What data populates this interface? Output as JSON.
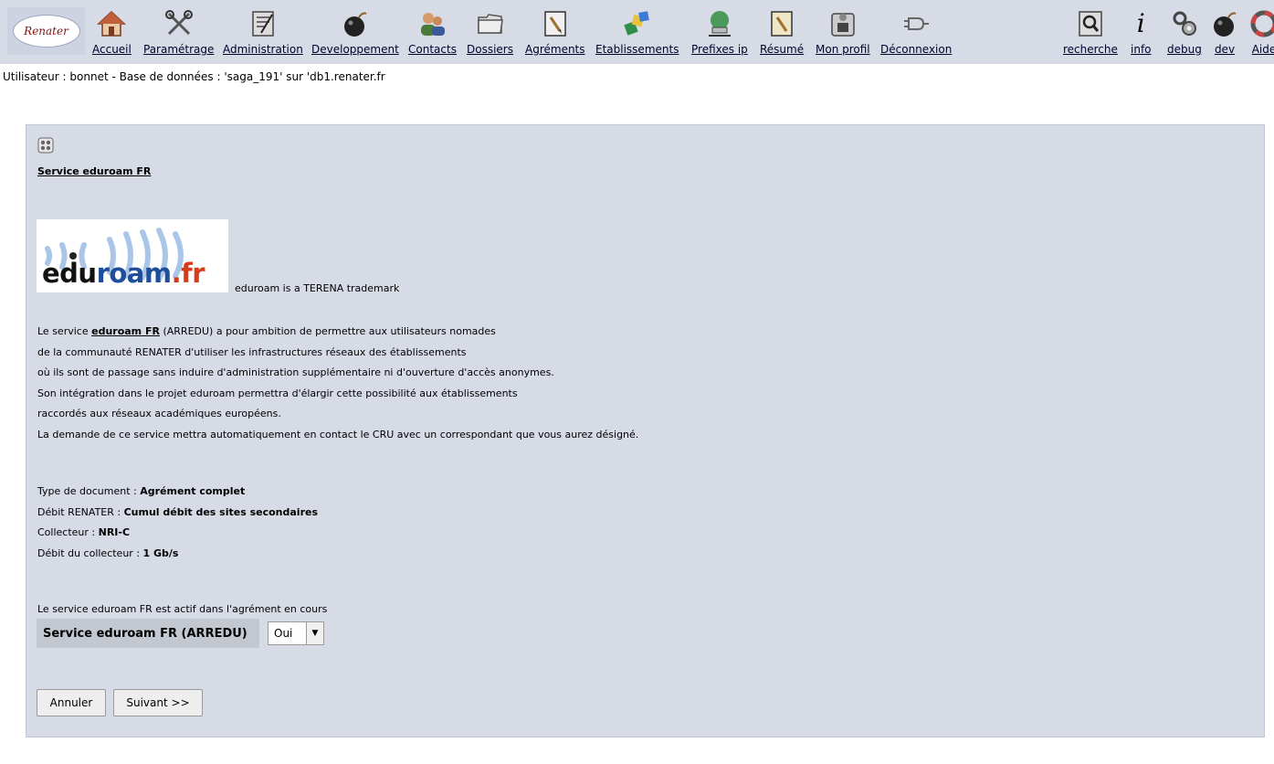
{
  "toolbar": {
    "logo_text": "Renater",
    "items": [
      {
        "label": "Accueil",
        "icon": "house-icon"
      },
      {
        "label": "Paramétrage",
        "icon": "tools-icon"
      },
      {
        "label": "Administration",
        "icon": "admin-icon"
      },
      {
        "label": "Developpement",
        "icon": "bomb-icon"
      },
      {
        "label": "Contacts",
        "icon": "people-icon"
      },
      {
        "label": "Dossiers",
        "icon": "folder-icon"
      },
      {
        "label": "Agréments",
        "icon": "pencil-doc-icon"
      },
      {
        "label": "Etablissements",
        "icon": "blocks-icon"
      },
      {
        "label": "Prefixes ip",
        "icon": "network-icon"
      },
      {
        "label": "Résumé",
        "icon": "summary-doc-icon"
      },
      {
        "label": "Mon profil",
        "icon": "profile-icon"
      },
      {
        "label": "Déconnexion",
        "icon": "plug-icon"
      }
    ],
    "right_items": [
      {
        "label": "recherche",
        "icon": "magnifier-icon"
      },
      {
        "label": "info",
        "icon": "info-icon"
      },
      {
        "label": "debug",
        "icon": "gears-icon"
      },
      {
        "label": "dev",
        "icon": "bomb-icon"
      },
      {
        "label": "Aide",
        "icon": "help-icon"
      }
    ]
  },
  "user_line": "Utilisateur : bonnet - Base de données : 'saga_191' sur 'db1.renater.fr",
  "service": {
    "title": "Service eduroam FR",
    "logo_text_edu": "edu",
    "logo_text_roam": "roam",
    "logo_text_fr": ".fr",
    "trademark": "eduroam is a TERENA trademark",
    "desc_line1_pre": "Le service ",
    "desc_line1_bold": "eduroam FR",
    "desc_line1_post": " (ARREDU) a pour ambition de permettre aux utilisateurs nomades",
    "desc_lines": [
      "de la communauté RENATER d'utiliser les infrastructures réseaux des établissements",
      "où ils sont de passage sans induire d'administration supplémentaire ni d'ouverture d'accès anonymes.",
      "Son intégration dans le projet eduroam permettra d'élargir cette possibilité aux établissements",
      "raccordés aux réseaux académiques européens.",
      "La demande de ce service mettra automatiquement en contact le CRU avec un correspondant que vous aurez désigné."
    ]
  },
  "details": {
    "type_label": "Type de document : ",
    "type_value": "Agrément complet",
    "debit_label": "Débit RENATER : ",
    "debit_value": "Cumul débit des sites secondaires",
    "collecteur_label": "Collecteur : ",
    "collecteur_value": "NRI-C",
    "debit_collecteur_label": "Débit du collecteur : ",
    "debit_collecteur_value": "1 Gb/s"
  },
  "active_text": "Le service eduroam FR est actif dans l'agrément en cours",
  "service_field": {
    "label": "Service eduroam FR (ARREDU)",
    "selected": "Oui"
  },
  "buttons": {
    "cancel": "Annuler",
    "next": "Suivant >>"
  }
}
